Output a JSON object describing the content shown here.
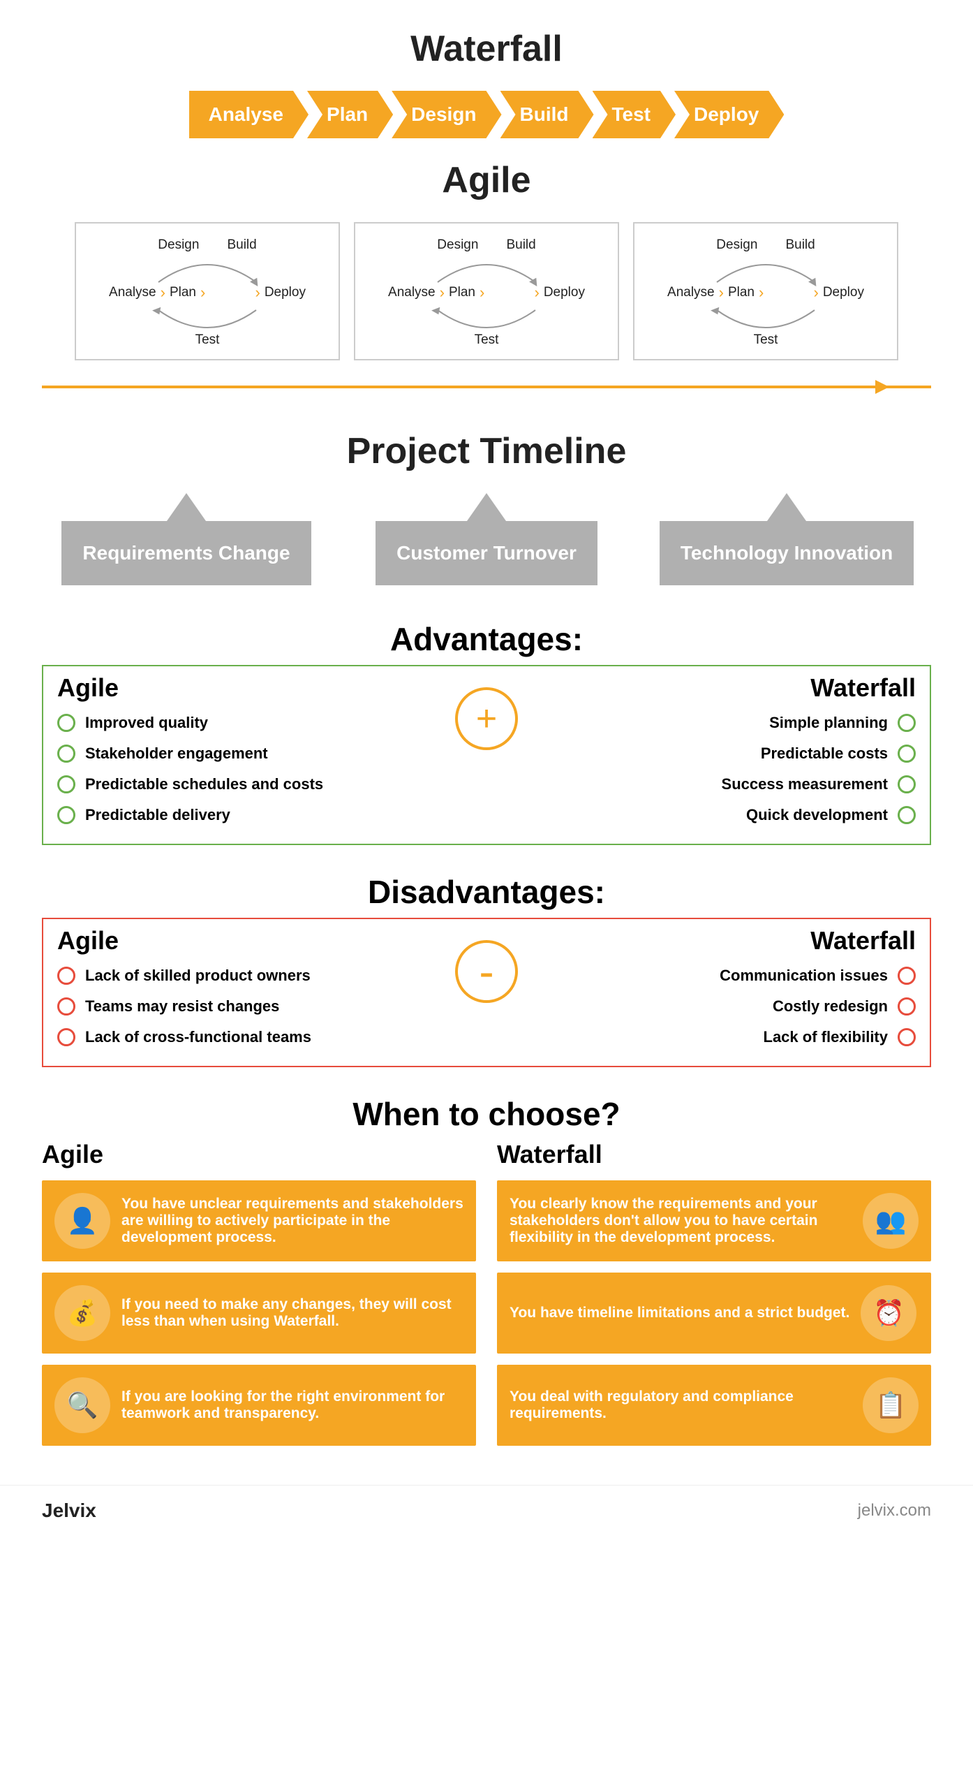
{
  "waterfall": {
    "title": "Waterfall",
    "steps": [
      "Analyse",
      "Plan",
      "Design",
      "Build",
      "Test",
      "Deploy"
    ]
  },
  "agile": {
    "title": "Agile",
    "cycles": [
      {
        "steps": [
          "Analyse",
          "Plan",
          "Design",
          "Build",
          "Test",
          "Deploy"
        ]
      },
      {
        "steps": [
          "Analyse",
          "Plan",
          "Design",
          "Build",
          "Test",
          "Deploy"
        ]
      },
      {
        "steps": [
          "Analyse",
          "Plan",
          "Design",
          "Build",
          "Test",
          "Deploy"
        ]
      }
    ]
  },
  "project_timeline": {
    "title": "Project Timeline",
    "items": [
      "Requirements Change",
      "Customer Turnover",
      "Technology Innovation"
    ]
  },
  "advantages": {
    "title": "Advantages:",
    "agile_label": "Agile",
    "waterfall_label": "Waterfall",
    "plus_symbol": "+",
    "agile_items": [
      "Improved quality",
      "Stakeholder engagement",
      "Predictable schedules and costs",
      "Predictable delivery"
    ],
    "waterfall_items": [
      "Simple planning",
      "Predictable costs",
      "Success measurement",
      "Quick development"
    ]
  },
  "disadvantages": {
    "title": "Disadvantages:",
    "agile_label": "Agile",
    "waterfall_label": "Waterfall",
    "minus_symbol": "-",
    "agile_items": [
      "Lack of skilled product owners",
      "Teams may resist changes",
      "Lack of cross-functional teams"
    ],
    "waterfall_items": [
      "Communication issues",
      "Costly redesign",
      "Lack of flexibility"
    ]
  },
  "when_to_choose": {
    "title": "When to choose?",
    "agile_label": "Agile",
    "waterfall_label": "Waterfall",
    "agile_cards": [
      "You have unclear requirements and stakeholders are willing to actively participate in the development process.",
      "If you need to make any changes, they will cost less than when using Waterfall.",
      "If you are looking for the right environment for teamwork and transparency."
    ],
    "waterfall_cards": [
      "You clearly know the requirements and your stakeholders don't allow you to have certain flexibility in the development process.",
      "You have timeline limitations and a strict budget.",
      "You deal with regulatory and compliance requirements."
    ],
    "agile_icons": [
      "👤",
      "💰",
      "🔍"
    ],
    "waterfall_icons": [
      "👥",
      "⏰",
      "📋"
    ]
  },
  "footer": {
    "brand": "Jelvix",
    "url": "jelvix.com"
  }
}
